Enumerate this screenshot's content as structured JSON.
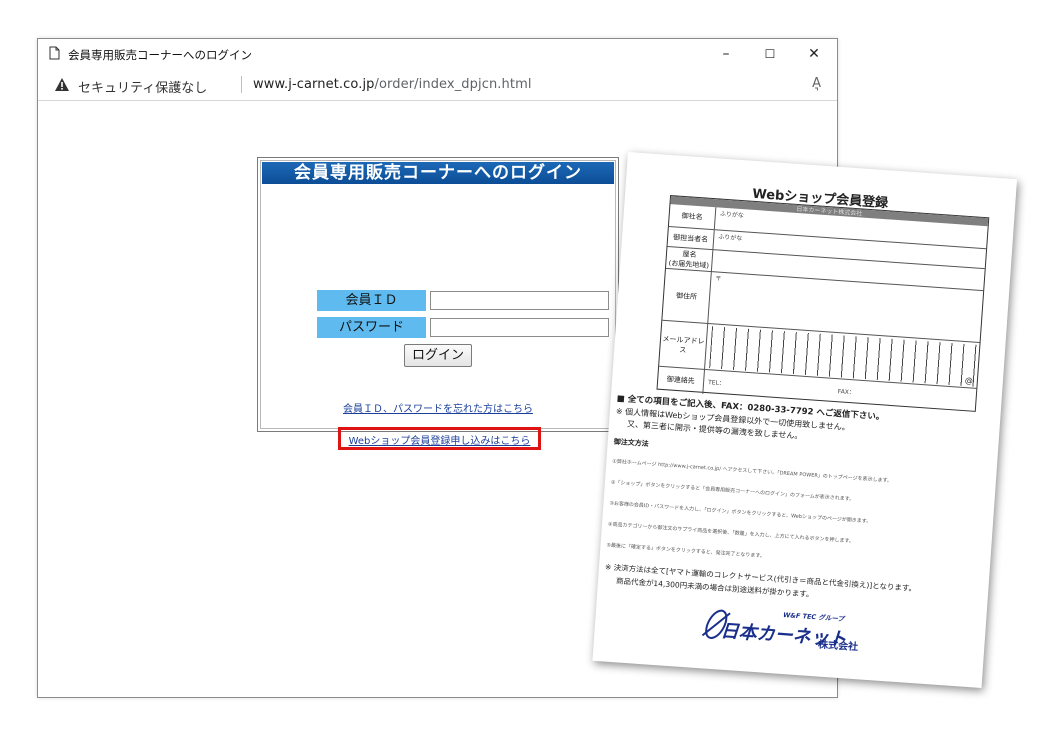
{
  "browser": {
    "title": "会員専用販売コーナーへのログイン",
    "minimize": "–",
    "maximize": "☐",
    "close": "✕",
    "security_label": "セキュリティ保護なし",
    "url_host": "www.j-carnet.co.jp",
    "url_path": "/order/index_dpjcn.html",
    "read_aloud": "A͉"
  },
  "login": {
    "heading": "会員専用販売コーナーへのログイン",
    "member_id_label": "会員ＩＤ",
    "member_id_value": "",
    "password_label": "パスワード",
    "password_value": "",
    "login_button": "ログイン",
    "forgot_link": "会員ＩＤ、パスワードを忘れた方はこちら",
    "signup_link": "Webショップ会員登録申し込みはこちら"
  },
  "form_sheet": {
    "title": "Webショップ会員登録",
    "header_strip": "日本カーネット株式会社",
    "rows": [
      {
        "sub": "ふりがな",
        "label": "御社名"
      },
      {
        "sub": "ふりがな",
        "label": "御担当者名"
      },
      {
        "sub": "",
        "label": "屋名\n(お届先地域)"
      },
      {
        "sub": "〒",
        "label": "御住所"
      },
      {
        "sub": "",
        "label": "メールアドレス"
      },
      {
        "sub": "TEL：",
        "label": "御連絡先",
        "fax": "FAX："
      }
    ],
    "at_mark": "@",
    "note_main": "■ 全ての項目をご記入後、FAX：0280-33-7792 へご返信下さい。",
    "note_privacy_1": "※ 個人情報はWebショップ会員登録以外で一切使用致しません。",
    "note_privacy_2": "又、第三者に開示・提供等の漏洩を致しません。",
    "order_heading": "御注文方法",
    "steps": [
      "①弊社ホームページ http://www.j-carnet.co.jp/ へアクセスして下さい。「DREAM POWER」のトップページを表示します。",
      "②「ショップ」ボタンをクリックすると「会員専用販売コーナーへのログイン」のフォームが表示されます。",
      "③お客様の会員ID・パスワードを入力し、「ログイン」ボタンをクリックすると、Webショップのページが開きます。",
      "④商品カテゴリーから御注文のサプライ商品を選択後、「数量」を入力し、上方にて入れるボタンを押します。",
      "⑤最後に「確定する」ボタンをクリックすると、発注完了となります。"
    ],
    "payment_note_1": "※ 決済方法は全て[ヤマト運輸のコレクトサービス(代引き＝商品と代金引換え)]となります。",
    "payment_note_2": "商品代金が14,300円未満の場合は別途送料が掛かります。",
    "logo_group": "W&F TEC グループ",
    "logo_name": "日本カーネット",
    "logo_corp": "株式会社"
  }
}
